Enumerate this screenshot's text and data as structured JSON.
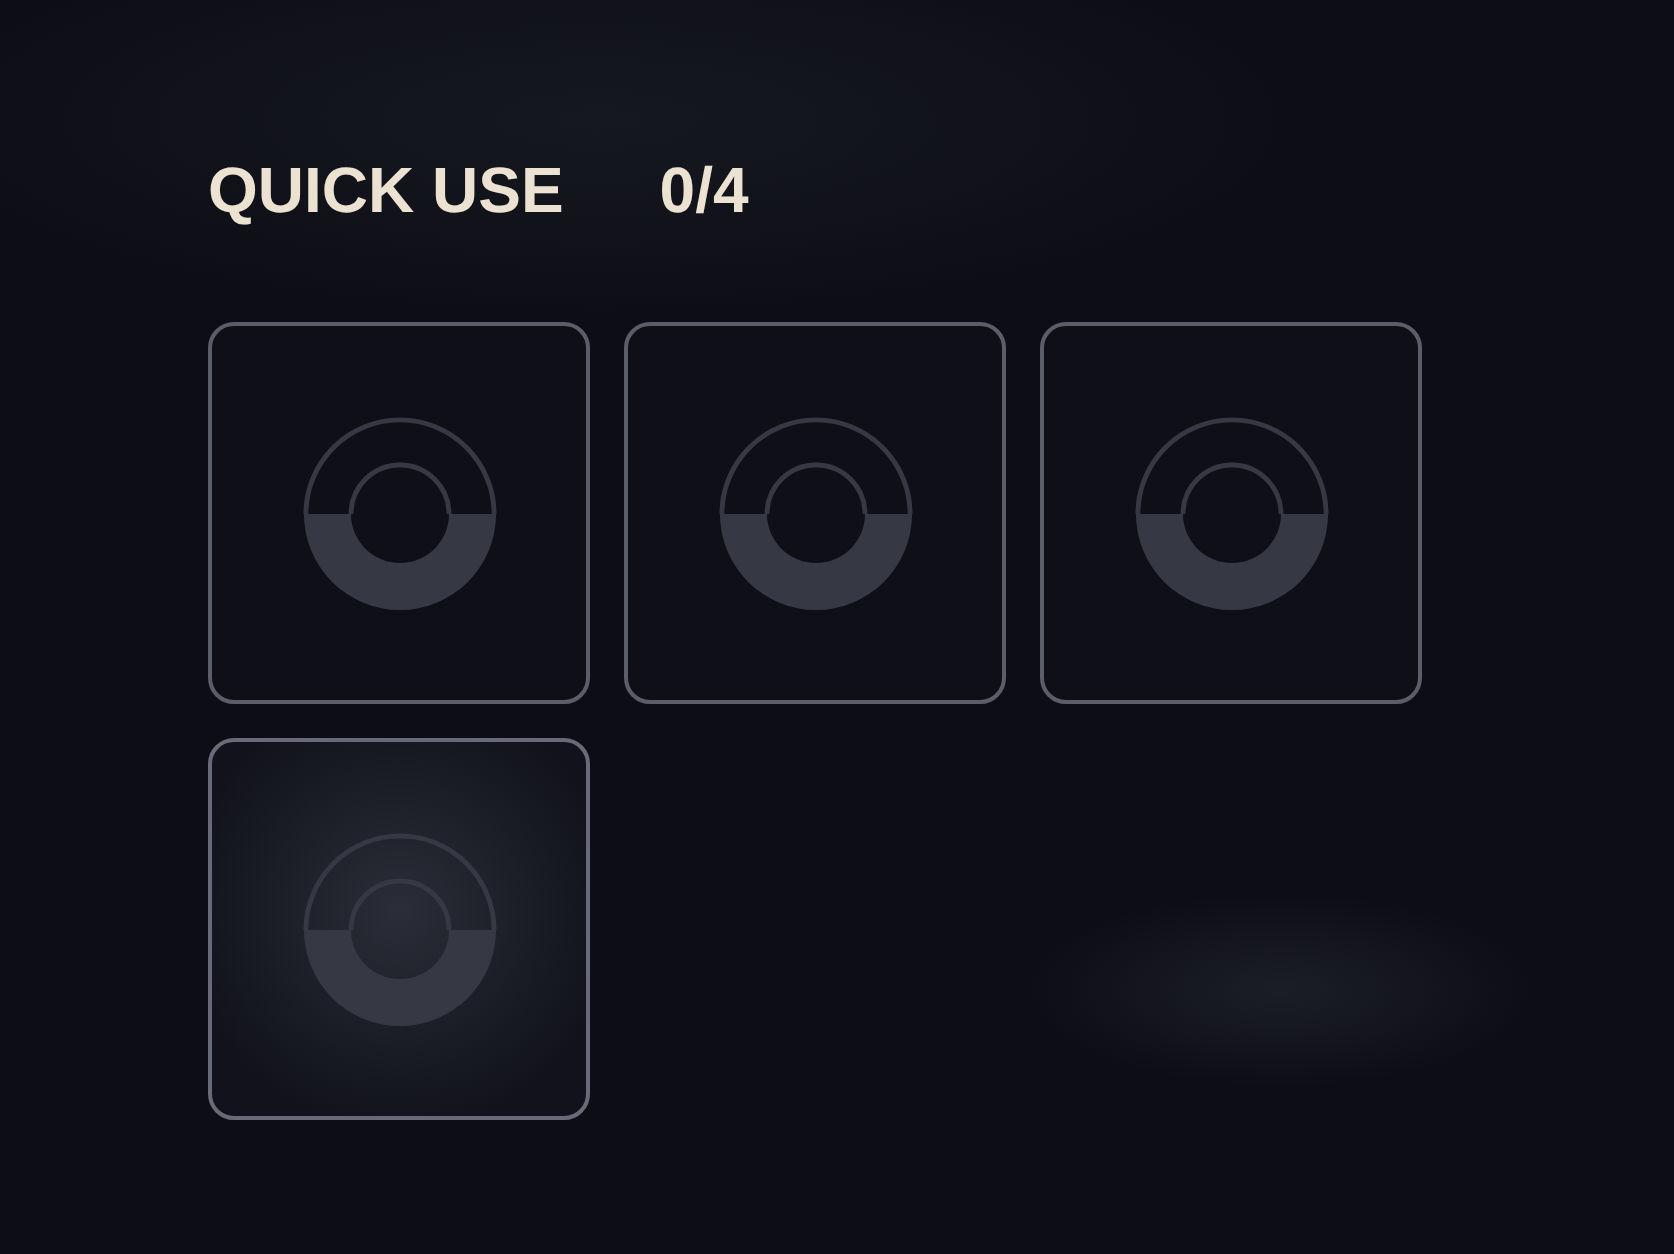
{
  "header": {
    "title": "QUICK USE",
    "count": "0/4"
  },
  "slots": [
    {
      "selected": false
    },
    {
      "selected": false
    },
    {
      "selected": false
    },
    {
      "selected": true
    }
  ]
}
